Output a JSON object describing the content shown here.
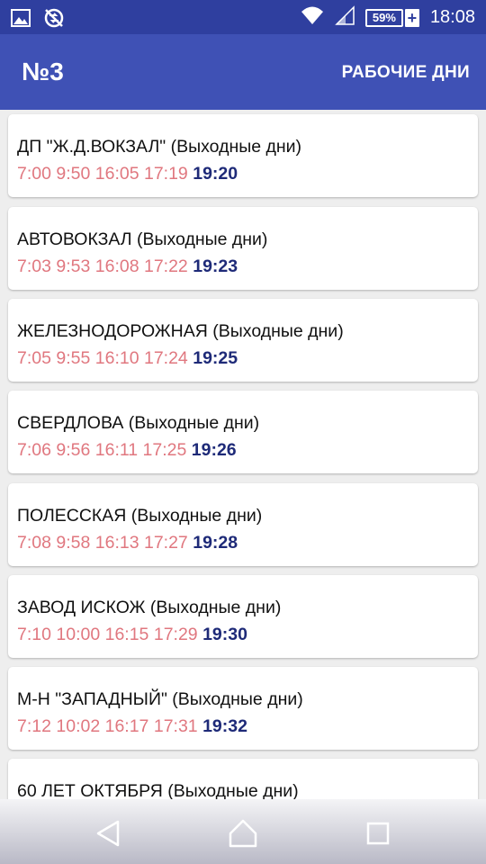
{
  "status_bar": {
    "battery_percent": "59%",
    "charging_symbol": "+",
    "time": "18:08",
    "icons": [
      "image-icon",
      "sync-disabled-icon",
      "wifi-icon",
      "signal-icon",
      "battery-icon"
    ]
  },
  "app_bar": {
    "title": "№3",
    "action_label": "РАБОЧИЕ ДНИ"
  },
  "stops": [
    {
      "name": "ДП \"Ж.Д.ВОКЗАЛ\" (Выходные дни)",
      "times": [
        "7:00",
        "9:50",
        "16:05",
        "17:19"
      ],
      "next": "19:20"
    },
    {
      "name": "АВТОВОКЗАЛ (Выходные дни)",
      "times": [
        "7:03",
        "9:53",
        "16:08",
        "17:22"
      ],
      "next": "19:23"
    },
    {
      "name": "ЖЕЛЕЗНОДОРОЖНАЯ (Выходные дни)",
      "times": [
        "7:05",
        "9:55",
        "16:10",
        "17:24"
      ],
      "next": "19:25"
    },
    {
      "name": "СВЕРДЛОВА (Выходные дни)",
      "times": [
        "7:06",
        "9:56",
        "16:11",
        "17:25"
      ],
      "next": "19:26"
    },
    {
      "name": "ПОЛЕССКАЯ (Выходные дни)",
      "times": [
        "7:08",
        "9:58",
        "16:13",
        "17:27"
      ],
      "next": "19:28"
    },
    {
      "name": "ЗАВОД ИСКОЖ (Выходные дни)",
      "times": [
        "7:10",
        "10:00",
        "16:15",
        "17:29"
      ],
      "next": "19:30"
    },
    {
      "name": "М-Н \"ЗАПАДНЫЙ\" (Выходные дни)",
      "times": [
        "7:12",
        "10:02",
        "16:17",
        "17:31"
      ],
      "next": "19:32"
    },
    {
      "name": "60 ЛЕТ ОКТЯБРЯ (Выходные дни)",
      "times": [],
      "next": ""
    }
  ],
  "nav_bar": {
    "icons": [
      "back-icon",
      "home-icon",
      "recents-icon"
    ]
  },
  "colors": {
    "status_bar": "#2f3f9f",
    "app_bar": "#3f51b5",
    "time": "#e0777f",
    "next_time": "#1e2a78"
  }
}
